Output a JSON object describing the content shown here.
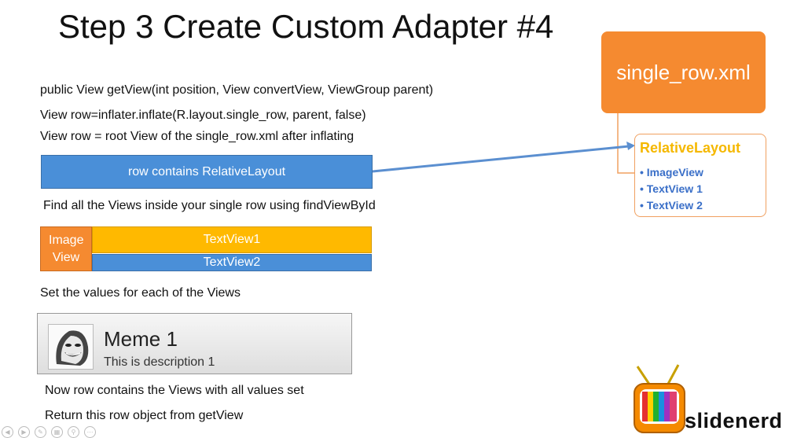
{
  "slide": {
    "title": "Step 3 Create Custom Adapter #4",
    "lines": {
      "get_view": "public View getView(int position, View convertView, ViewGroup parent)",
      "inflate": "View row=inflater.inflate(R.layout.single_row, parent, false)",
      "root_view": "View row = root View of the single_row.xml after inflating",
      "find_views": "Find all the Views inside your single row using findViewById",
      "set_values": "Set the values for each of the Views",
      "row_contains": "Now row contains the Views with all values set",
      "return_row": "Return this row object from getView"
    },
    "row_bar": {
      "label": "row contains RelativeLayout"
    },
    "layout_diagram": {
      "image_view": "Image View",
      "text_view1": "TextView1",
      "text_view2": "TextView2"
    },
    "xml_box": {
      "label": "single_row.xml"
    },
    "relative_layout": {
      "title": "RelativeLayout",
      "items": [
        {
          "label": "ImageView"
        },
        {
          "label": "TextView 1"
        },
        {
          "label": "TextView 2"
        }
      ]
    },
    "sample_row": {
      "title": "Meme 1",
      "description": "This is description 1"
    },
    "logo": {
      "text": "slidenerd"
    }
  },
  "colors": {
    "blue": "#4a8fd8",
    "orange": "#f58a30",
    "yellow": "#ffb900",
    "link_blue": "#3a6fc8"
  }
}
